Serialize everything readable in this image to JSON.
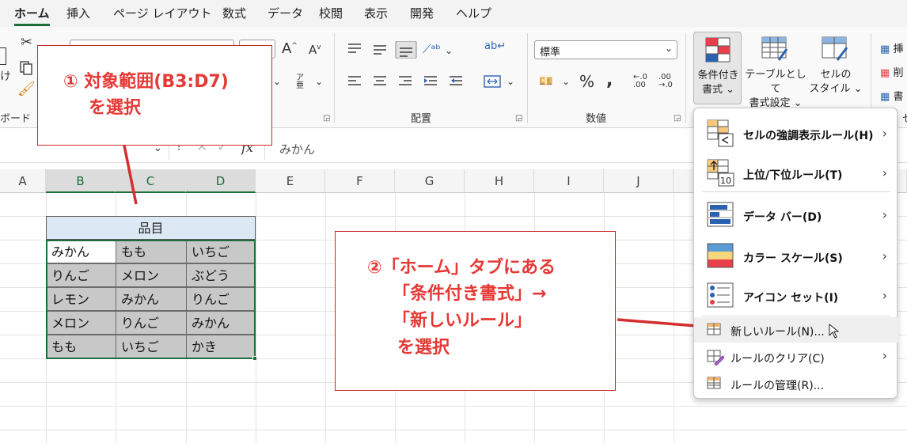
{
  "tabs": [
    "ホーム",
    "挿入",
    "ページ レイアウト",
    "数式",
    "データ",
    "校閲",
    "表示",
    "開発",
    "ヘルプ"
  ],
  "ribbon": {
    "clipboard_label": "ボード",
    "paste_label": "け",
    "alignment_label": "配置",
    "number_label": "数値",
    "number_format": "標準",
    "font_grow": "A",
    "font_shrink": "A",
    "furigana": "ア亜",
    "cond_format_label": "条件付き書式",
    "cond_format_line1": "条件付き",
    "cond_format_line2": "書式",
    "table_format_line1": "テーブルとして",
    "table_format_line2": "書式設定",
    "cell_style_line1": "セルの",
    "cell_style_line2": "スタイル",
    "right_items": [
      "挿",
      "削",
      "書"
    ],
    "right_label": "セ"
  },
  "formula_bar": {
    "fx": "fx",
    "value": "みかん"
  },
  "columns": [
    "A",
    "B",
    "C",
    "D",
    "E",
    "F",
    "G",
    "H",
    "I",
    "J"
  ],
  "table": {
    "header": "品目",
    "rows": [
      [
        "みかん",
        "もも",
        "いちご"
      ],
      [
        "りんご",
        "メロン",
        "ぶどう"
      ],
      [
        "レモン",
        "みかん",
        "りんご"
      ],
      [
        "メロン",
        "りんご",
        "みかん"
      ],
      [
        "もも",
        "いちご",
        "かき"
      ]
    ]
  },
  "callout1": {
    "line1": "① 対象範囲(B3:D7)",
    "line2": "を選択"
  },
  "callout2": {
    "line1": "②「ホーム」タブにある",
    "line2": "「条件付き書式」→",
    "line3": "「新しいルール」",
    "line4": "を選択"
  },
  "menu": {
    "highlight_rules": "セルの強調表示ルール(H)",
    "topbottom_rules": "上位/下位ルール(T)",
    "data_bars": "データ バー(D)",
    "color_scales": "カラー スケール(S)",
    "icon_sets": "アイコン セット(I)",
    "new_rule": "新しいルール(N)...",
    "clear_rules": "ルールのクリア(C)",
    "manage_rules": "ルールの管理(R)..."
  },
  "colors": {
    "accent": "#1e6e3c",
    "callout_red": "#e53935",
    "selection_fill": "#c8c8c8"
  }
}
